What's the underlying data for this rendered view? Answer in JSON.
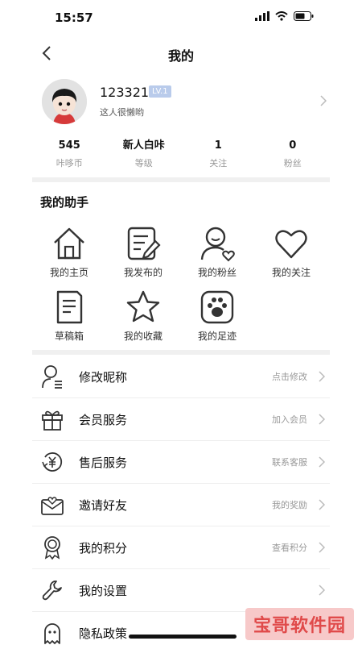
{
  "status_bar": {
    "time": "15:57"
  },
  "nav": {
    "title": "我的"
  },
  "profile": {
    "name": "123321",
    "level": "LV.1",
    "bio": "这人很懒哟"
  },
  "stats": [
    {
      "value": "545",
      "label": "咔哆币"
    },
    {
      "value": "新人白咔",
      "label": "等级"
    },
    {
      "value": "1",
      "label": "关注"
    },
    {
      "value": "0",
      "label": "粉丝"
    }
  ],
  "assistant": {
    "title": "我的助手",
    "items": [
      {
        "label": "我的主页",
        "icon": "home-icon"
      },
      {
        "label": "我发布的",
        "icon": "edit-note-icon"
      },
      {
        "label": "我的粉丝",
        "icon": "fans-icon"
      },
      {
        "label": "我的关注",
        "icon": "heart-icon"
      },
      {
        "label": "草稿箱",
        "icon": "draft-icon"
      },
      {
        "label": "我的收藏",
        "icon": "star-icon"
      },
      {
        "label": "我的足迹",
        "icon": "paw-icon"
      }
    ]
  },
  "menu": [
    {
      "label": "修改昵称",
      "hint": "点击修改",
      "icon": "nickname-icon"
    },
    {
      "label": "会员服务",
      "hint": "加入会员",
      "icon": "gift-icon"
    },
    {
      "label": "售后服务",
      "hint": "联系客服",
      "icon": "yen-service-icon"
    },
    {
      "label": "邀请好友",
      "hint": "我的奖励",
      "icon": "invite-mail-icon"
    },
    {
      "label": "我的积分",
      "hint": "查看积分",
      "icon": "medal-icon"
    },
    {
      "label": "我的设置",
      "hint": "",
      "icon": "wrench-icon"
    },
    {
      "label": "隐私政策",
      "hint": "",
      "icon": "ghost-icon"
    }
  ],
  "watermark": {
    "text": "宝哥软件园"
  }
}
